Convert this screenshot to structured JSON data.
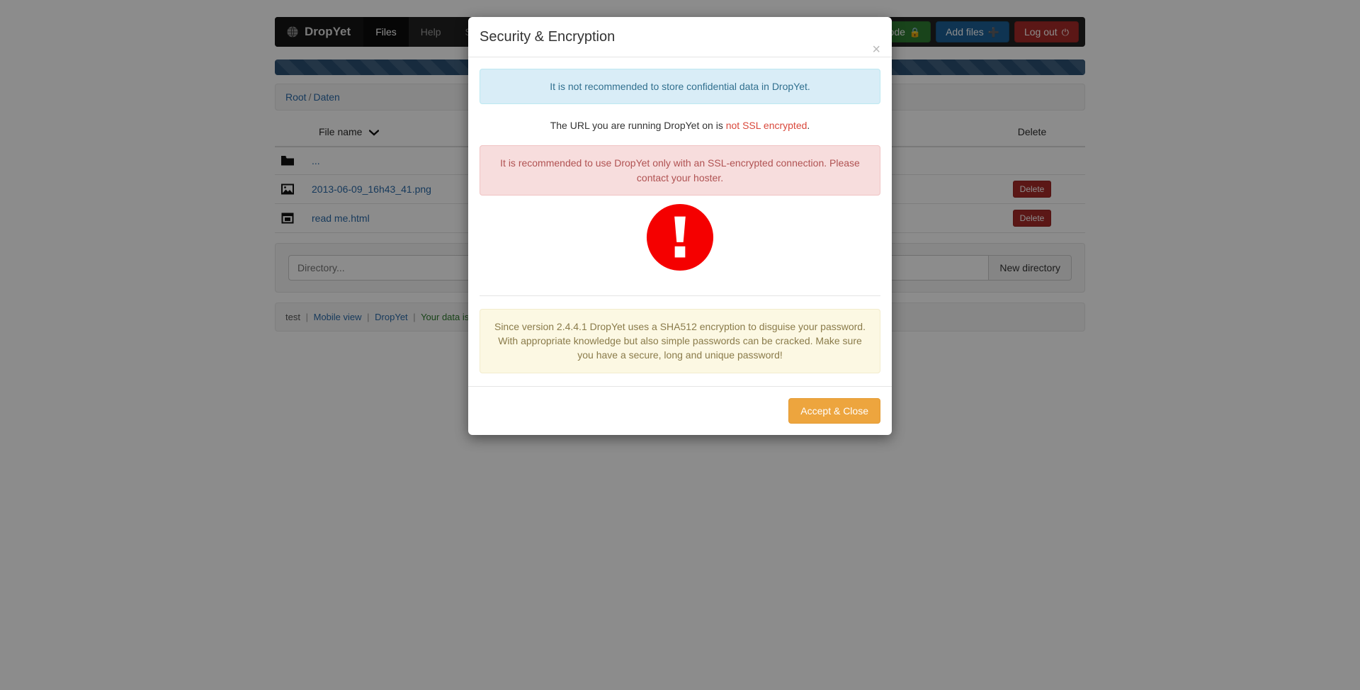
{
  "navbar": {
    "brand": "DropYet",
    "brand_icon": "globe-icon",
    "items": [
      {
        "label": "Files",
        "active": true
      },
      {
        "label": "Help",
        "active": false
      },
      {
        "label": "Settings",
        "active": false
      }
    ],
    "buttons": {
      "secure_mode": {
        "label": "Secure mode",
        "icon": "lock-icon",
        "color": "#2e7d32"
      },
      "add_files": {
        "label": "Add files",
        "icon": "plus-icon",
        "color": "#1c5f96"
      },
      "log_out": {
        "label": "Log out",
        "icon": "power-icon",
        "color": "#a62a28"
      }
    }
  },
  "progress": {
    "value": 100,
    "style": "striped",
    "color": "#2a4f72"
  },
  "breadcrumb": {
    "root": "Root",
    "separator": "/",
    "current": "Daten"
  },
  "files_table": {
    "headers": {
      "name": "File name",
      "sort_icon": "chevron-down-icon",
      "delete": "Delete"
    },
    "rows": [
      {
        "icon": "folder-icon",
        "name": "...",
        "delete_label": "",
        "has_delete": false
      },
      {
        "icon": "image-icon",
        "name": "2013-06-09_16h43_41.png",
        "delete_label": "Delete",
        "has_delete": true
      },
      {
        "icon": "html-file-icon",
        "name": "read me.html",
        "delete_label": "Delete",
        "has_delete": true
      }
    ]
  },
  "directory_bar": {
    "input_placeholder": "Directory...",
    "input_value": "",
    "button_label": "New directory"
  },
  "footer": {
    "user": "test",
    "mobile_view": "Mobile view",
    "app": "DropYet",
    "status": "Your data is",
    "separator": "|"
  },
  "modal": {
    "title": "Security & Encryption",
    "close_icon": "close-icon",
    "info_alert": "It is not recommended to store confidential data in DropYet.",
    "ssl_prefix": "The URL you are running DropYet on is ",
    "ssl_status": "not SSL encrypted",
    "ssl_suffix": ".",
    "danger_alert": "It is recommended to use DropYet only with an SSL-encrypted connection. Please contact your hoster.",
    "warning_icon": "exclamation-circle-icon",
    "warning_color": "#f50000",
    "note_alert": "Since version 2.4.4.1 DropYet uses a SHA512 encryption to disguise your password. With appropriate knowledge but also simple passwords can be cracked. Make sure you have a secure, long and unique password!",
    "accept_button": "Accept & Close"
  }
}
